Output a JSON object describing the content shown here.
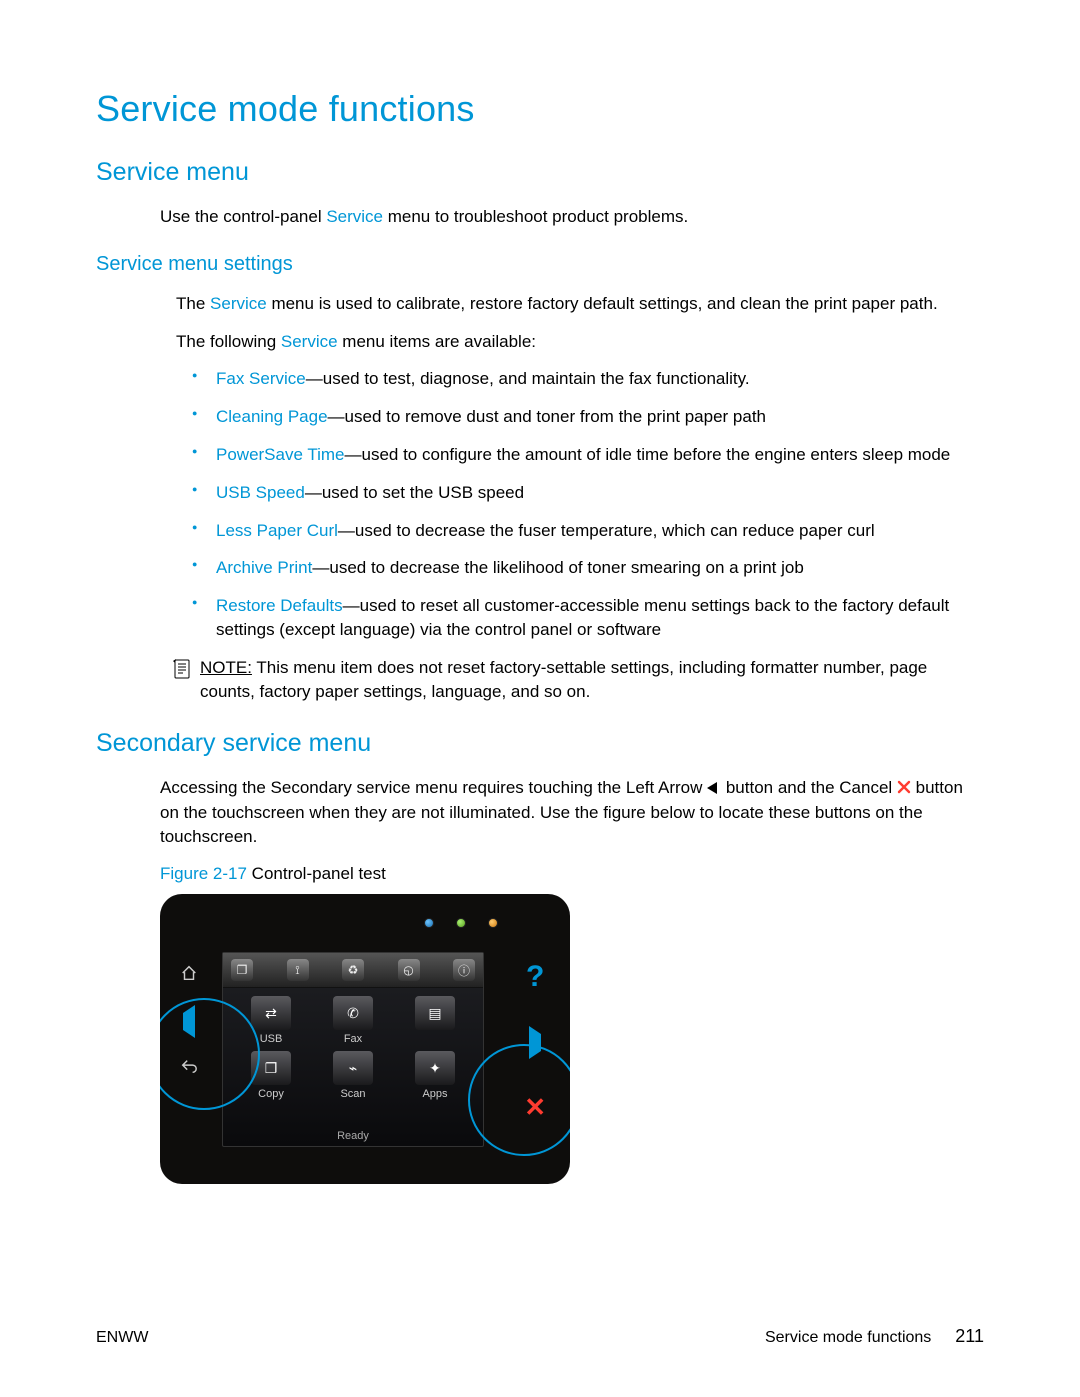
{
  "h1": "Service mode functions",
  "h2_service_menu": "Service menu",
  "p_service_intro_a": "Use the control-panel ",
  "p_service_intro_link": "Service",
  "p_service_intro_b": " menu to troubleshoot product problems.",
  "h3_settings": "Service menu settings",
  "p_settings_1_a": "The ",
  "p_settings_1_link": "Service",
  "p_settings_1_b": " menu is used to calibrate, restore factory default settings, and clean the print paper path.",
  "p_settings_2_a": "The following ",
  "p_settings_2_link": "Service",
  "p_settings_2_b": " menu items are available:",
  "bullets": [
    {
      "term": "Fax Service",
      "desc": "—used to test, diagnose, and maintain the fax functionality."
    },
    {
      "term": "Cleaning Page",
      "desc": "—used to remove dust and toner from the print paper path"
    },
    {
      "term": "PowerSave Time",
      "desc": "—used to configure the amount of idle time before the engine enters sleep mode"
    },
    {
      "term": "USB Speed",
      "desc": "—used to set the USB speed"
    },
    {
      "term": "Less Paper Curl",
      "desc": "—used to decrease the fuser temperature, which can reduce paper curl"
    },
    {
      "term": "Archive Print",
      "desc": "—used to decrease the likelihood of toner smearing on a print job"
    },
    {
      "term": "Restore Defaults",
      "desc": "—used to reset all customer-accessible menu settings back to the factory default settings (except language) via the control panel or software"
    }
  ],
  "note_label": "NOTE:",
  "note_body": " This menu item does not reset factory-settable settings, including formatter number, page counts, factory paper settings, language, and so on.",
  "h2_secondary": "Secondary service menu",
  "p_secondary_a": "Accessing the Secondary service menu requires touching the Left Arrow ",
  "p_secondary_b": " button and the Cancel ",
  "p_secondary_c": " button on the touchscreen when they are not illuminated. Use the figure below to locate these buttons on the touchscreen.",
  "fig_label": "Figure 2-17",
  "fig_title": "  Control-panel test",
  "panel": {
    "apps": [
      "USB",
      "Fax",
      "",
      "Copy",
      "Scan",
      "Apps"
    ],
    "status": "Ready"
  },
  "footer_left": "ENWW",
  "footer_section": "Service mode functions",
  "footer_page": "211"
}
